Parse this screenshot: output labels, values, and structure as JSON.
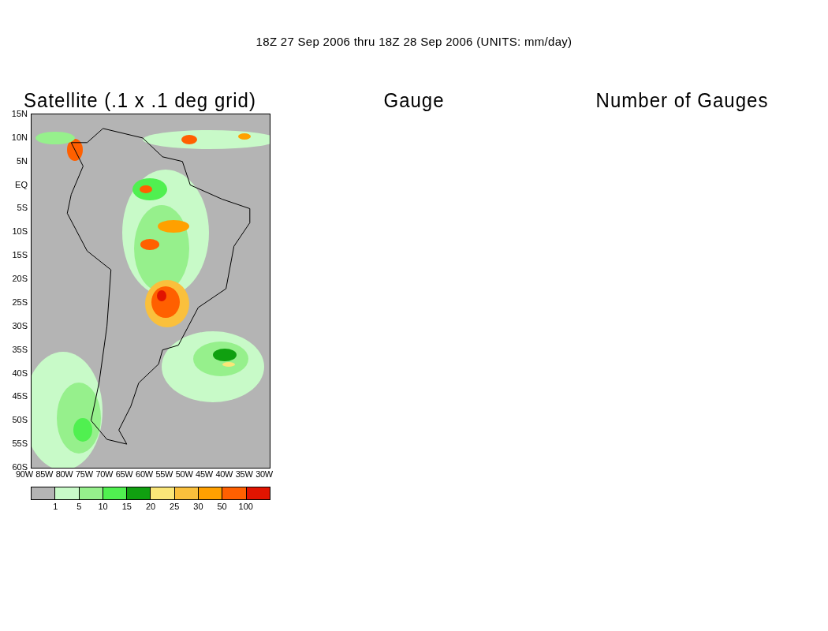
{
  "title": "18Z 27 Sep 2006 thru 18Z 28 Sep 2006 (UNITS: mm/day)",
  "panels": [
    {
      "title": "Satellite (.1 x .1 deg grid)"
    },
    {
      "title": "Gauge"
    },
    {
      "title": "Number of Gauges"
    }
  ],
  "map": {
    "y_ticks": [
      "15N",
      "10N",
      "5N",
      "EQ",
      "5S",
      "10S",
      "15S",
      "20S",
      "25S",
      "30S",
      "35S",
      "40S",
      "45S",
      "50S",
      "55S",
      "60S"
    ],
    "x_ticks": [
      "90W",
      "85W",
      "80W",
      "75W",
      "70W",
      "65W",
      "60W",
      "55W",
      "50W",
      "45W",
      "40W",
      "35W",
      "30W"
    ]
  },
  "colorbar": {
    "swatches": [
      {
        "color": "#b4b4b4"
      },
      {
        "color": "#c8fac8"
      },
      {
        "color": "#96f08c"
      },
      {
        "color": "#50f050"
      },
      {
        "color": "#10a010"
      },
      {
        "color": "#fae678"
      },
      {
        "color": "#fac03c"
      },
      {
        "color": "#ffa000"
      },
      {
        "color": "#ff6000"
      },
      {
        "color": "#e11400"
      }
    ],
    "labels": [
      "1",
      "5",
      "10",
      "15",
      "20",
      "25",
      "30",
      "50",
      "100"
    ]
  }
}
